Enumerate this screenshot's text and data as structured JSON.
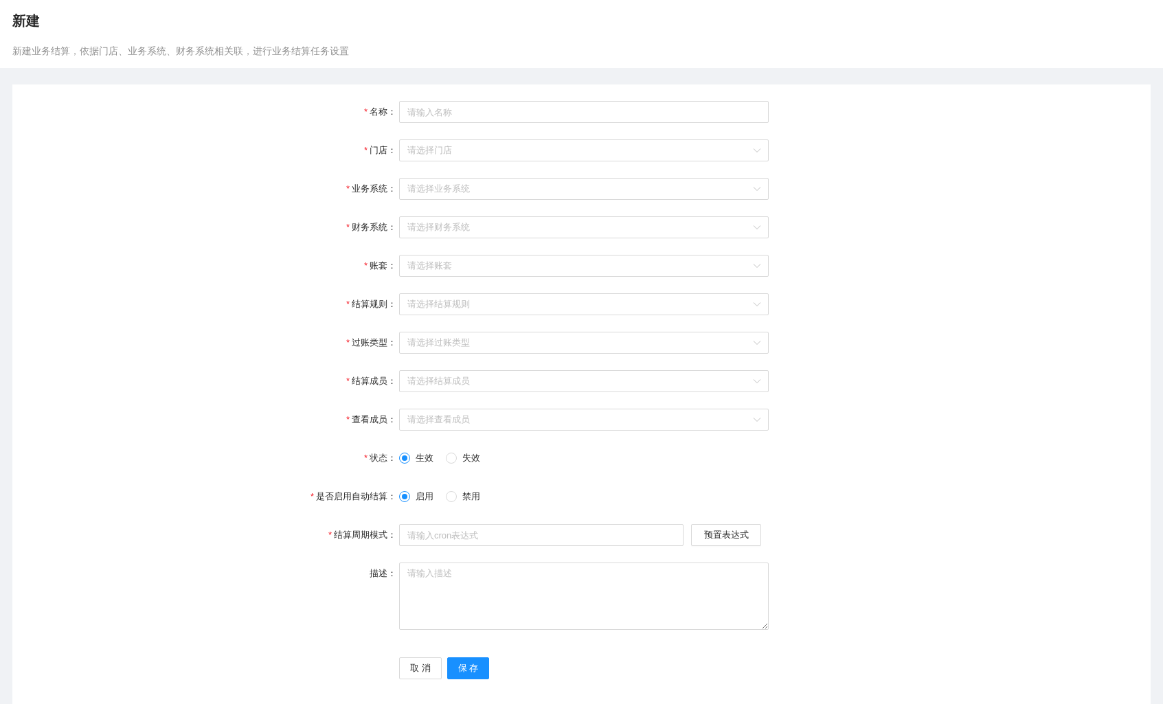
{
  "header": {
    "title": "新建",
    "description": "新建业务结算，依据门店、业务系统、财务系统相关联，进行业务结算任务设置"
  },
  "fields": [
    {
      "kind": "input",
      "marker": "*",
      "label": "名称：",
      "placeholder": "请输入名称"
    },
    {
      "kind": "select",
      "marker": "*",
      "label": "门店：",
      "placeholder": "请选择门店"
    },
    {
      "kind": "select",
      "marker": "*",
      "label": "业务系统：",
      "placeholder": "请选择业务系统"
    },
    {
      "kind": "select",
      "marker": "*",
      "label": "财务系统：",
      "placeholder": "请选择财务系统"
    },
    {
      "kind": "select",
      "marker": "*",
      "label": "账套：",
      "placeholder": "请选择账套"
    },
    {
      "kind": "select",
      "marker": "*",
      "label": "结算规则：",
      "placeholder": "请选择结算规则"
    },
    {
      "kind": "select",
      "marker": "*",
      "label": "过账类型：",
      "placeholder": "请选择过账类型"
    },
    {
      "kind": "select",
      "marker": "*",
      "label": "结算成员：",
      "placeholder": "请选择结算成员"
    },
    {
      "kind": "select",
      "marker": "*",
      "label": "查看成员：",
      "placeholder": "请选择查看成员"
    },
    {
      "kind": "radio",
      "marker": "*",
      "label": "状态：",
      "options": [
        {
          "label": "生效",
          "selected": true
        },
        {
          "label": "失效",
          "selected": false
        }
      ]
    },
    {
      "kind": "radio",
      "marker": "*",
      "label": "是否启用自动结算：",
      "options": [
        {
          "label": "启用",
          "selected": true
        },
        {
          "label": "禁用",
          "selected": false
        }
      ]
    },
    {
      "kind": "cron",
      "marker": "*",
      "label": "结算周期模式：",
      "placeholder": "请输入cron表达式",
      "button": "预置表达式"
    },
    {
      "kind": "textarea",
      "label": "描述：",
      "placeholder": "请输入描述"
    }
  ],
  "actions": [
    {
      "label": "取 消",
      "kind": "default"
    },
    {
      "label": "保 存",
      "kind": "primary"
    }
  ]
}
